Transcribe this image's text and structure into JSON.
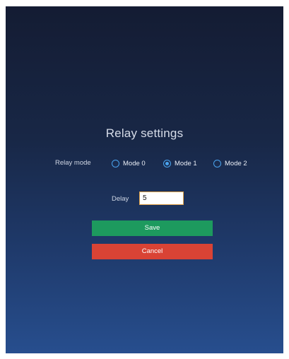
{
  "dialog": {
    "title": "Relay settings",
    "relay_mode_label": "Relay mode",
    "modes": [
      {
        "label": "Mode 0",
        "checked": false
      },
      {
        "label": "Mode 1",
        "checked": true
      },
      {
        "label": "Mode 2",
        "checked": false
      }
    ],
    "delay_label": "Delay",
    "delay_value": "5",
    "save_label": "Save",
    "cancel_label": "Cancel"
  },
  "colors": {
    "save": "#1d9a5e",
    "cancel": "#d94335",
    "radio_accent": "#4aa3ee",
    "input_border": "#e0a24a"
  }
}
